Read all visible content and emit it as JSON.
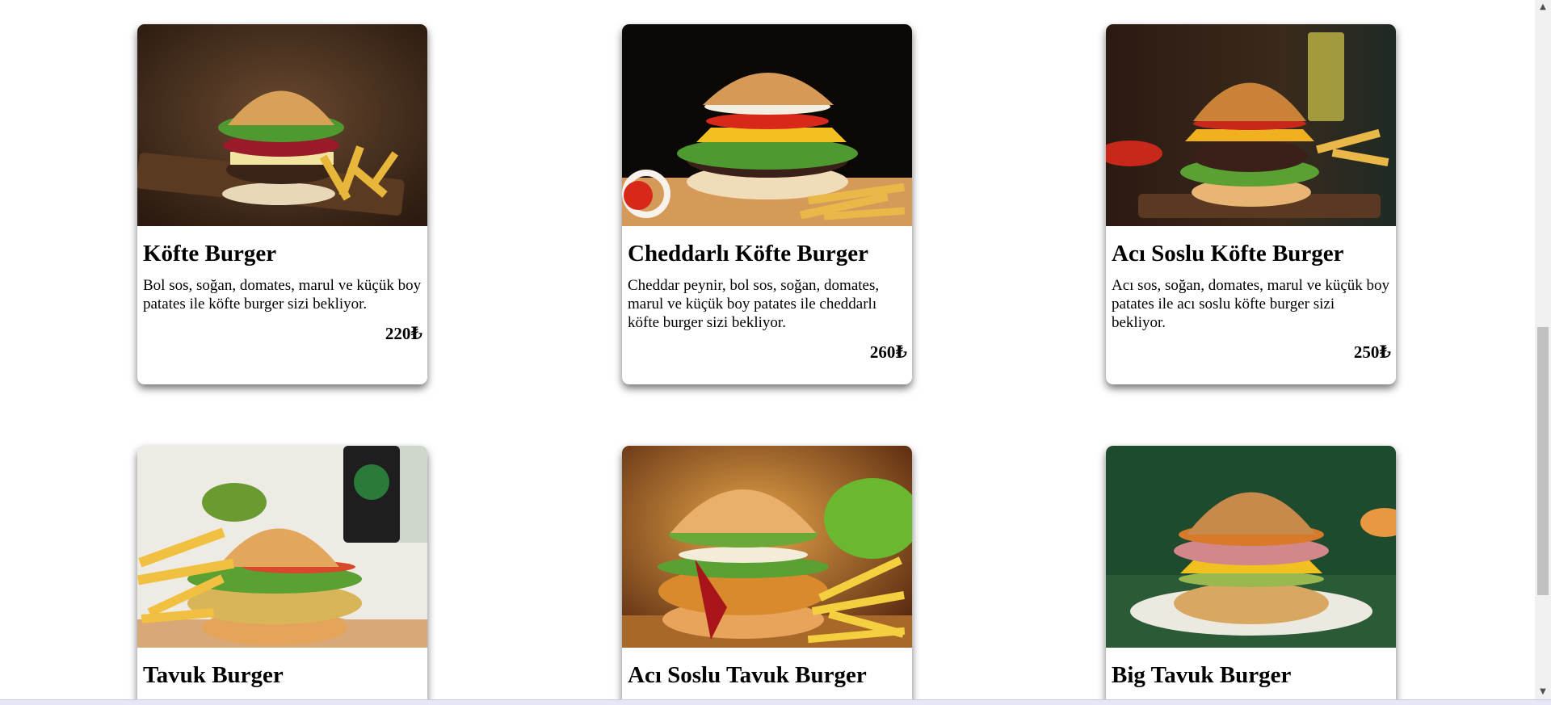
{
  "currency_symbol": "₺",
  "cards": [
    {
      "title": "Köfte Burger",
      "description": "Bol sos, soğan, domates, marul ve küçük boy patates ile köfte burger sizi bekliyor.",
      "price": "220₺",
      "image": "kofte-burger-image"
    },
    {
      "title": "Cheddarlı Köfte Burger",
      "description": "Cheddar peynir, bol sos, soğan, domates, marul ve küçük boy patates ile cheddarlı köfte burger sizi bekliyor.",
      "price": "260₺",
      "image": "cheddar-burger-image"
    },
    {
      "title": "Acı Soslu Köfte Burger",
      "description": "Acı sos, soğan, domates, marul ve küçük boy patates ile acı soslu köfte burger sizi bekliyor.",
      "price": "250₺",
      "image": "spicy-burger-image"
    },
    {
      "title": "Tavuk Burger",
      "description": "",
      "price": "",
      "image": "chicken-burger-image"
    },
    {
      "title": "Acı Soslu Tavuk Burger",
      "description": "",
      "price": "",
      "image": "spicy-chicken-burger-image"
    },
    {
      "title": "Big Tavuk Burger",
      "description": "",
      "price": "",
      "image": "big-chicken-burger-image"
    }
  ]
}
